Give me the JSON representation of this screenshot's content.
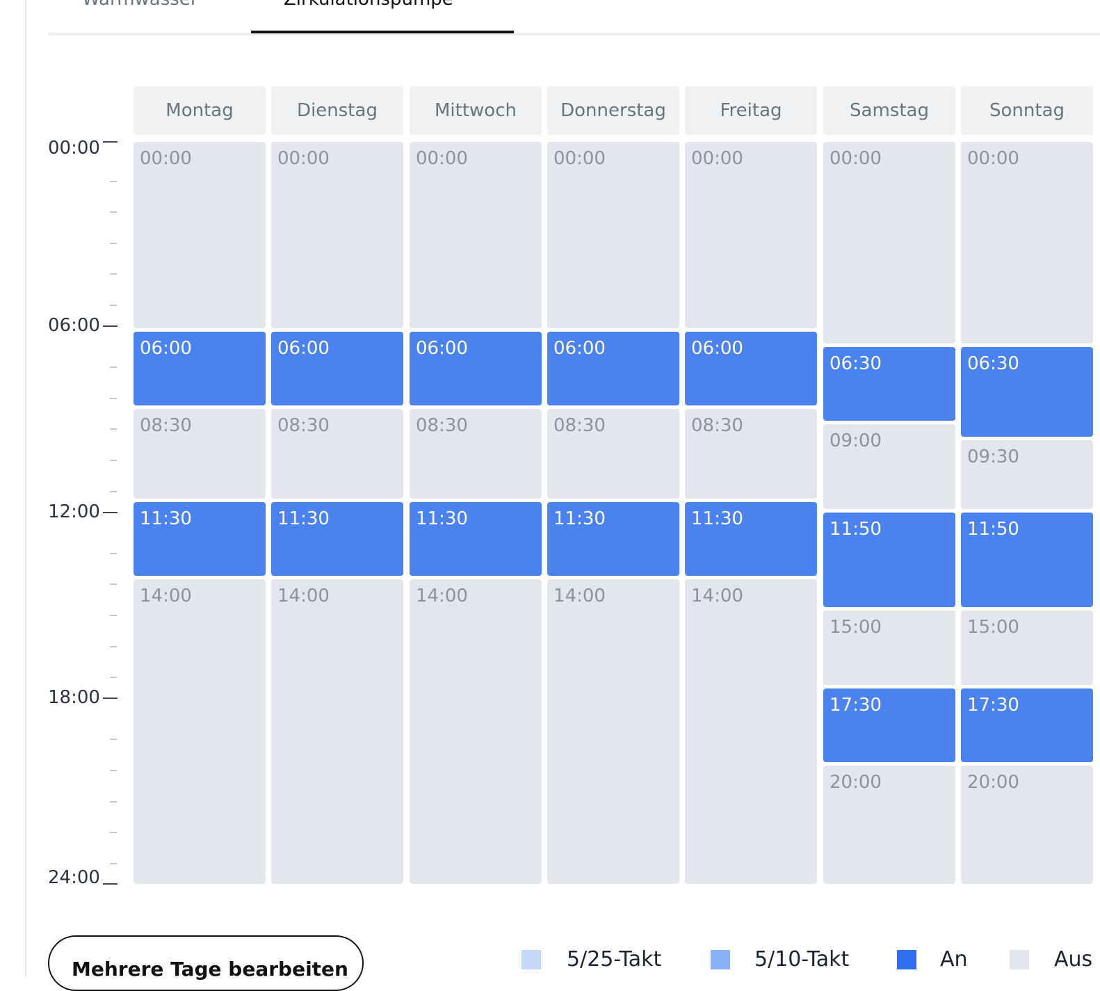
{
  "tabs": [
    {
      "label": "Warmwasser",
      "active": false
    },
    {
      "label": "Zirkulationspumpe",
      "active": true
    }
  ],
  "time_axis": [
    "00:00",
    "06:00",
    "12:00",
    "18:00",
    "24:00"
  ],
  "days": [
    {
      "name": "Montag",
      "segments": [
        {
          "start": "00:00",
          "state": "off"
        },
        {
          "start": "06:00",
          "state": "on"
        },
        {
          "start": "08:30",
          "state": "off"
        },
        {
          "start": "11:30",
          "state": "on"
        },
        {
          "start": "14:00",
          "state": "off"
        }
      ]
    },
    {
      "name": "Dienstag",
      "segments": [
        {
          "start": "00:00",
          "state": "off"
        },
        {
          "start": "06:00",
          "state": "on"
        },
        {
          "start": "08:30",
          "state": "off"
        },
        {
          "start": "11:30",
          "state": "on"
        },
        {
          "start": "14:00",
          "state": "off"
        }
      ]
    },
    {
      "name": "Mittwoch",
      "segments": [
        {
          "start": "00:00",
          "state": "off"
        },
        {
          "start": "06:00",
          "state": "on"
        },
        {
          "start": "08:30",
          "state": "off"
        },
        {
          "start": "11:30",
          "state": "on"
        },
        {
          "start": "14:00",
          "state": "off"
        }
      ]
    },
    {
      "name": "Donnerstag",
      "segments": [
        {
          "start": "00:00",
          "state": "off"
        },
        {
          "start": "06:00",
          "state": "on"
        },
        {
          "start": "08:30",
          "state": "off"
        },
        {
          "start": "11:30",
          "state": "on"
        },
        {
          "start": "14:00",
          "state": "off"
        }
      ]
    },
    {
      "name": "Freitag",
      "segments": [
        {
          "start": "00:00",
          "state": "off"
        },
        {
          "start": "06:00",
          "state": "on"
        },
        {
          "start": "08:30",
          "state": "off"
        },
        {
          "start": "11:30",
          "state": "on"
        },
        {
          "start": "14:00",
          "state": "off"
        }
      ]
    },
    {
      "name": "Samstag",
      "segments": [
        {
          "start": "00:00",
          "state": "off"
        },
        {
          "start": "06:30",
          "state": "on"
        },
        {
          "start": "09:00",
          "state": "off"
        },
        {
          "start": "11:50",
          "state": "on"
        },
        {
          "start": "15:00",
          "state": "off"
        },
        {
          "start": "17:30",
          "state": "on"
        },
        {
          "start": "20:00",
          "state": "off"
        }
      ]
    },
    {
      "name": "Sonntag",
      "segments": [
        {
          "start": "00:00",
          "state": "off"
        },
        {
          "start": "06:30",
          "state": "on"
        },
        {
          "start": "09:30",
          "state": "off"
        },
        {
          "start": "11:50",
          "state": "on"
        },
        {
          "start": "15:00",
          "state": "off"
        },
        {
          "start": "17:30",
          "state": "on"
        },
        {
          "start": "20:00",
          "state": "off"
        }
      ]
    }
  ],
  "actions": {
    "edit_multiple_label": "Mehrere Tage bearbeiten"
  },
  "legend": [
    {
      "label": "5/25-Takt",
      "color": "#c6d8fa"
    },
    {
      "label": "5/10-Takt",
      "color": "#8ab0f5"
    },
    {
      "label": "An",
      "color": "#2f6ef0"
    },
    {
      "label": "Aus",
      "color": "#e4e6ee"
    }
  ],
  "colors": {
    "on": "#4a82f0",
    "off": "#e4e6ee",
    "header_bg": "#f0f1f3"
  }
}
